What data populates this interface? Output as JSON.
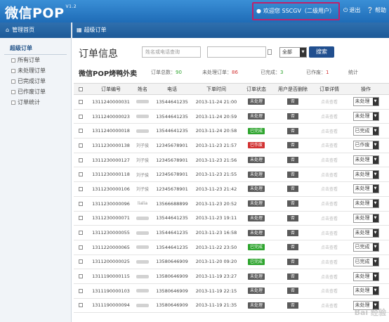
{
  "header": {
    "logo": "微信POP",
    "version": "V1.2",
    "welcome": "欢迎您 SSCGV（二级用户）",
    "logout": "退出",
    "help": "帮助"
  },
  "sidebar": {
    "home": "管理首页",
    "section_title": "超级订单",
    "items": [
      {
        "label": "所有订单"
      },
      {
        "label": "未处理订单"
      },
      {
        "label": "已完成订单"
      },
      {
        "label": "已作废订单"
      },
      {
        "label": "订单统计"
      }
    ]
  },
  "main": {
    "breadcrumb": "超级订单",
    "title": "订单信息",
    "search_placeholder": "姓名或电话查询",
    "status_select": "全部",
    "search_button": "搜索",
    "subtitle": "微信POP烤鸭外卖",
    "stats": {
      "total_label": "订单总数：",
      "total_value": "90",
      "pending_label": "未处理订单：",
      "pending_value": "86",
      "done_label": "已完成：",
      "done_value": "3",
      "void_label": "已作废：",
      "void_value": "1",
      "stats_link": "统计"
    },
    "table": {
      "headers": [
        "订单编号",
        "姓名",
        "电话",
        "下单时间",
        "订单状态",
        "用户是否删除",
        "订单详情",
        "操作"
      ],
      "delete_text": "否",
      "detail_text": "点击查看",
      "rows": [
        {
          "id": "1311240000031",
          "name": "",
          "phone": "13544641235",
          "time": "2013-11-24 21:00",
          "status": "未处理",
          "status_color": "#5a5a5a",
          "op": "未处理"
        },
        {
          "id": "1311240000023",
          "name": "",
          "phone": "13544641235",
          "time": "2013-11-24 20:59",
          "status": "未处理",
          "status_color": "#5a5a5a",
          "op": "未处理"
        },
        {
          "id": "1311240000018",
          "name": "",
          "phone": "13544641235",
          "time": "2013-11-24 20:58",
          "status": "已完成",
          "status_color": "#2fa52f",
          "op": "已完成"
        },
        {
          "id": "1311230000138",
          "name": "刘子骏",
          "phone": "12345678901",
          "time": "2013-11-23 21:57",
          "status": "已作废",
          "status_color": "#d23232",
          "op": "已作废"
        },
        {
          "id": "1311230000127",
          "name": "刘子骏",
          "phone": "12345678901",
          "time": "2013-11-23 21:56",
          "status": "未处理",
          "status_color": "#5a5a5a",
          "op": "未处理"
        },
        {
          "id": "1311230000118",
          "name": "刘子骏",
          "phone": "12345678901",
          "time": "2013-11-23 21:55",
          "status": "未处理",
          "status_color": "#5a5a5a",
          "op": "未处理"
        },
        {
          "id": "1311230000106",
          "name": "刘子骏",
          "phone": "12345678901",
          "time": "2013-11-23 21:42",
          "status": "未处理",
          "status_color": "#5a5a5a",
          "op": "未处理"
        },
        {
          "id": "1311230000096",
          "name": "lialia",
          "phone": "13566688899",
          "time": "2013-11-23 20:52",
          "status": "未处理",
          "status_color": "#5a5a5a",
          "op": "未处理"
        },
        {
          "id": "1311230000071",
          "name": "",
          "phone": "13544641235",
          "time": "2013-11-23 19:11",
          "status": "未处理",
          "status_color": "#5a5a5a",
          "op": "未处理"
        },
        {
          "id": "1311230000055",
          "name": "",
          "phone": "13544641235",
          "time": "2013-11-23 16:58",
          "status": "未处理",
          "status_color": "#5a5a5a",
          "op": "未处理"
        },
        {
          "id": "1311220000065",
          "name": "",
          "phone": "13544641235",
          "time": "2013-11-22 23:50",
          "status": "已完成",
          "status_color": "#2fa52f",
          "op": "已完成"
        },
        {
          "id": "1311200000025",
          "name": "",
          "phone": "13580646909",
          "time": "2013-11-20 09:20",
          "status": "已完成",
          "status_color": "#2fa52f",
          "op": "已完成"
        },
        {
          "id": "1311190000115",
          "name": "",
          "phone": "13580646909",
          "time": "2013-11-19 23:27",
          "status": "未处理",
          "status_color": "#5a5a5a",
          "op": "未处理"
        },
        {
          "id": "1311190000103",
          "name": "",
          "phone": "13580646909",
          "time": "2013-11-19 22:15",
          "status": "未处理",
          "status_color": "#5a5a5a",
          "op": "未处理"
        },
        {
          "id": "1311190000094",
          "name": "",
          "phone": "13580646909",
          "time": "2013-11-19 21:35",
          "status": "未处理",
          "status_color": "#5a5a5a",
          "op": "未处理"
        }
      ]
    }
  },
  "watermark": "Bai 经验"
}
